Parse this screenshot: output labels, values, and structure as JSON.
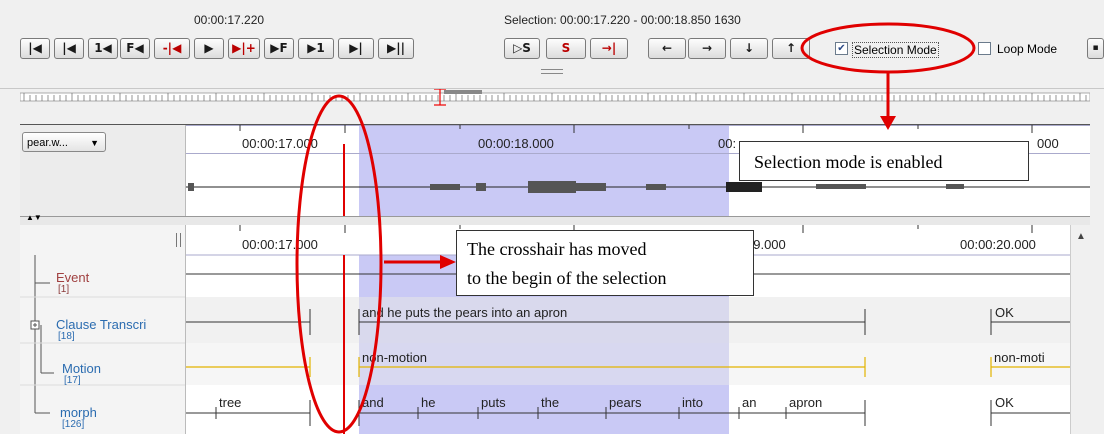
{
  "toolbar": {
    "current_time": "00:00:17.220",
    "selection_text": "Selection: 00:00:17.220 - 00:00:18.850  1630",
    "nav_buttons": [
      "|◀",
      "|◀",
      "1◀",
      "F◀",
      "-|◀",
      "▶",
      "▶|+",
      "▶F",
      "▶1",
      "▶|",
      "▶||"
    ],
    "sel_buttons": [
      "▷S",
      "S",
      "→|"
    ],
    "arrow_buttons": [
      "←",
      "→",
      "↓",
      "↑"
    ],
    "selection_mode_label": "Selection Mode",
    "selection_mode_checked": true,
    "loop_mode_label": "Loop Mode",
    "loop_mode_checked": false
  },
  "waveform": {
    "file_selector": "pear.w...",
    "ticks": [
      "00:00:17.000",
      "00:00:18.000",
      "00:",
      "000"
    ]
  },
  "timeline": {
    "ticks": [
      "00:00:17.000",
      "19.000",
      "00:00:20.000"
    ]
  },
  "tiers": [
    {
      "name": "Event",
      "count": "[1]"
    },
    {
      "name": "Clause Transcri",
      "count": "[18]"
    },
    {
      "name": "Motion",
      "count": "[17]"
    },
    {
      "name": "morph",
      "count": "[126]"
    }
  ],
  "annotations": {
    "clause": [
      "and he puts the pears into an apron",
      "OK"
    ],
    "motion": [
      "non-motion",
      "non-moti"
    ],
    "morph": [
      "tree",
      "and",
      "he",
      "puts",
      "the",
      "pears",
      "into",
      "an",
      "apron",
      "OK"
    ]
  },
  "callouts": {
    "selection_mode": "Selection mode is enabled",
    "crosshair_line1": "The crosshair has moved",
    "crosshair_line2": "to the begin of the selection"
  },
  "colors": {
    "selection": "#c9c9f5",
    "crosshair": "#e00000",
    "motion_line": "#e3b400",
    "callout_ellipse": "#e00000"
  }
}
